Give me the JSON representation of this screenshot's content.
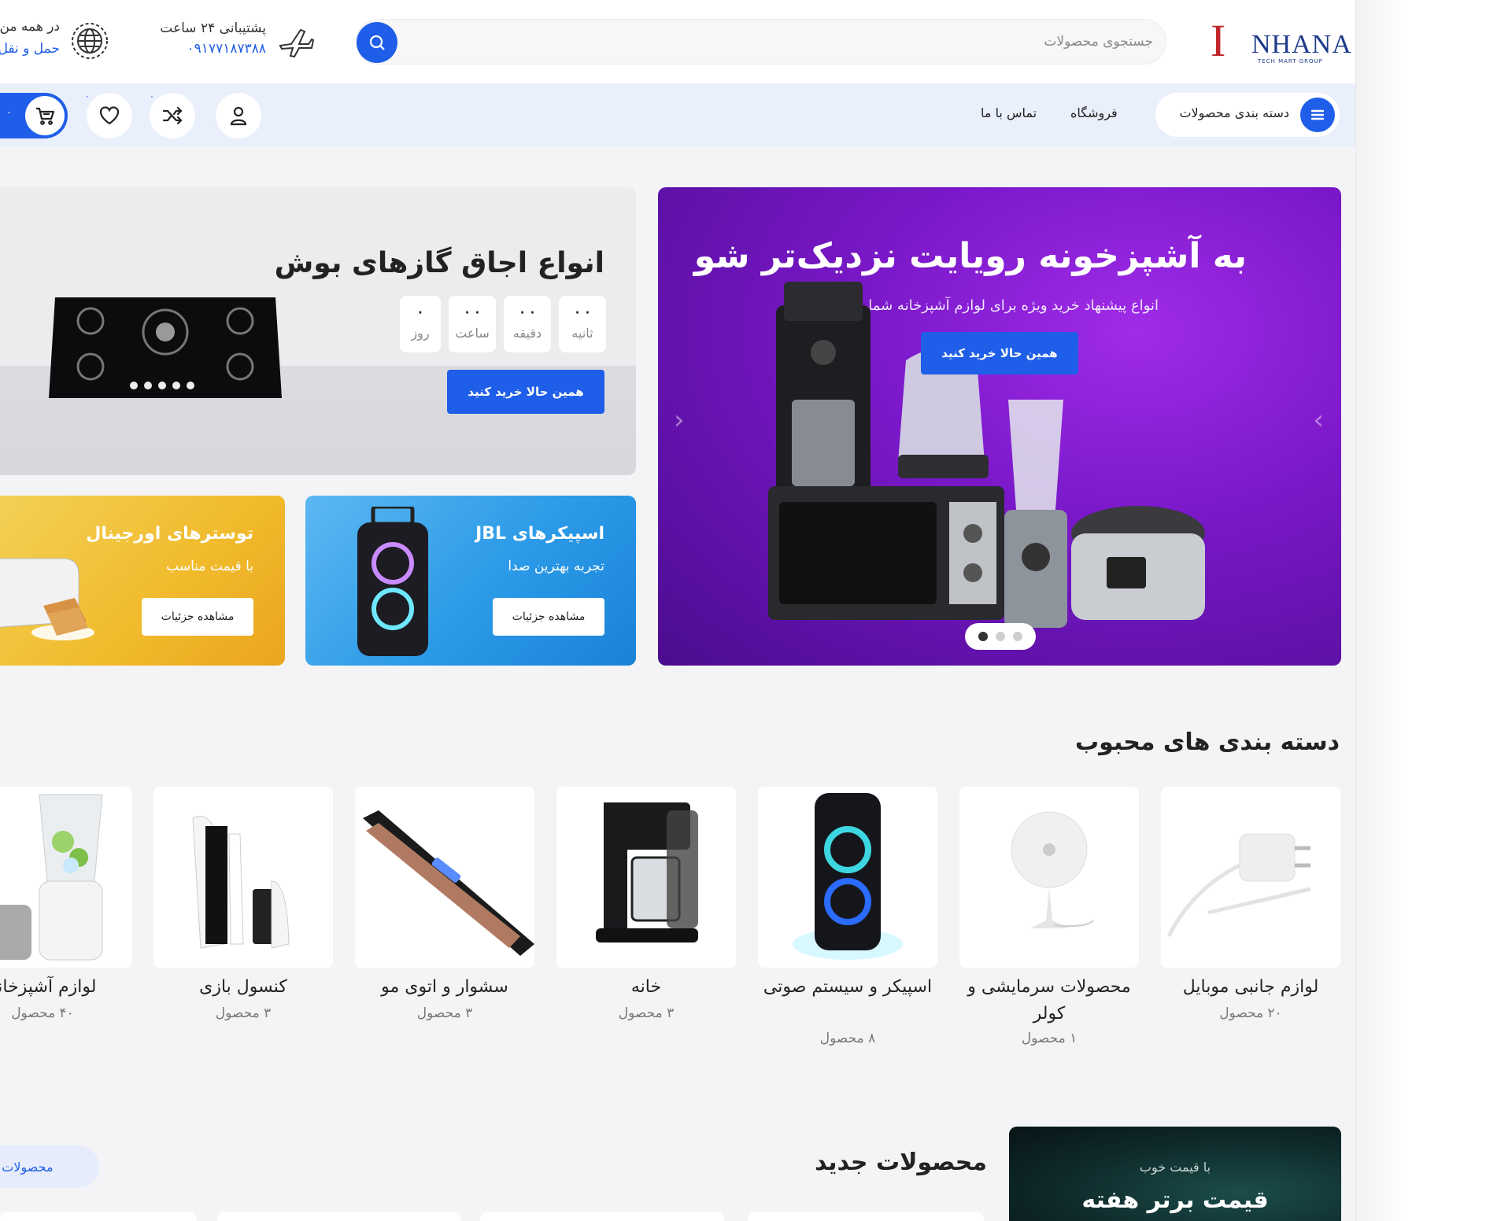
{
  "header": {
    "logo_text": "NHANA",
    "logo_mark": "I",
    "logo_subtitle": "TECH MART GROUP",
    "search": {
      "placeholder": "جستجوی محصولات"
    },
    "support": {
      "label": "پشتیبانی ۲۴ ساعت",
      "phone": "۰۹۱۷۷۱۸۷۳۸۸"
    },
    "shipping": {
      "label": "در همه من",
      "sub": "حمل و نقل"
    }
  },
  "nav": {
    "categories_label": "دسته بندی محصولات",
    "links": [
      "فروشگاه",
      "تماس با ما"
    ],
    "compare_count": "۰",
    "wishlist_count": "۰",
    "cart_count": "۰"
  },
  "hero": {
    "title": "به آشپزخونه رویایت نزدیک‌تر شو",
    "subtitle": "انواع پیشنهاد خرید ویژه برای لوازم آشپزخانه شما",
    "cta": "همین حالا خرید کنید",
    "slides": 3,
    "active_slide": 3
  },
  "gas_banner": {
    "title": "انواع اجاق گازهای بوش",
    "timer": [
      {
        "value": "۰۰",
        "label": "ثانیه"
      },
      {
        "value": "۰۰",
        "label": "دقیقه"
      },
      {
        "value": "۰۰",
        "label": "ساعت"
      },
      {
        "value": "۰",
        "label": "روز"
      }
    ],
    "cta": "همین حالا خرید کنید"
  },
  "promo_jbl": {
    "title": "اسپیکرهای JBL",
    "subtitle": "تجربه بهترین صدا",
    "cta": "مشاهده جزئیات"
  },
  "promo_toaster": {
    "title": "توسترهای اورجینال",
    "subtitle": "با قیمت مناسب",
    "cta": "مشاهده جزئیات"
  },
  "popular_categories": {
    "title": "دسته بندی های محبوب",
    "items": [
      {
        "name": "لوازم جانبی موبایل",
        "count": "۲۰ محصول"
      },
      {
        "name": "محصولات سرمایشی و کولر",
        "count": "۱ محصول"
      },
      {
        "name": "اسپیکر و سیستم صوتی",
        "count": "۸ محصول"
      },
      {
        "name": "خانه",
        "count": "۳ محصول"
      },
      {
        "name": "سشوار و اتوی مو",
        "count": "۳ محصول"
      },
      {
        "name": "کنسول بازی",
        "count": "۳ محصول"
      },
      {
        "name": "لوازم آشپزخانه",
        "count": "۴۰ محصول"
      }
    ]
  },
  "new_products": {
    "title": "محصولات جدید",
    "more_label": "محصولات بیشتر"
  },
  "weekly_deal": {
    "subtitle": "با قیمت خوب",
    "title": "قیمت برتر هفته"
  },
  "colors": {
    "primary": "#1f5ee8",
    "hero_purple": "#7a18c9",
    "nav_bg": "#e9effb",
    "jbl_blue": "#2b9ae8",
    "toaster_yellow": "#f1bb2d"
  }
}
